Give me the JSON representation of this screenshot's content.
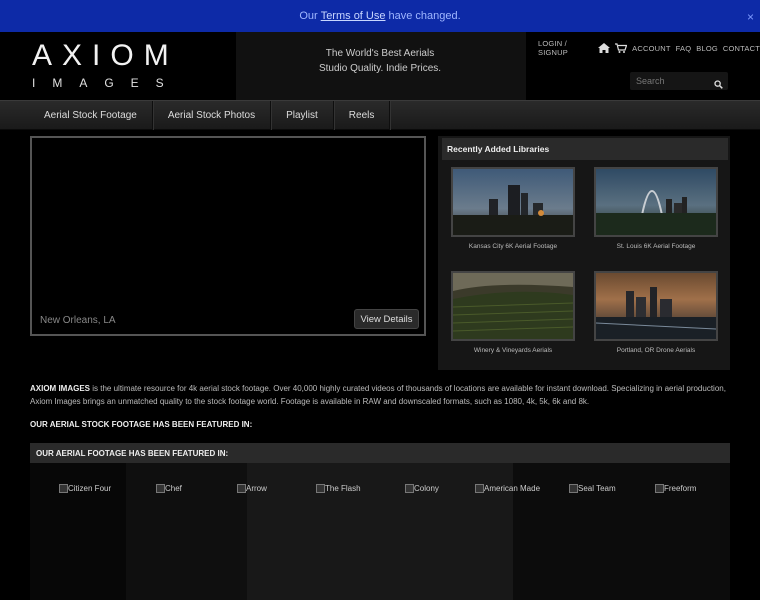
{
  "notice": {
    "prefix": "Our",
    "link": "Terms of Use",
    "suffix": "have changed.",
    "close": "×"
  },
  "brand": {
    "top": "AXIOM",
    "bottom": "IMAGES"
  },
  "tagline": {
    "line1": "The World's Best Aerials",
    "line2": "Studio Quality. Indie Prices."
  },
  "topnav": {
    "login": "LOGIN / SIGNUP",
    "account": "ACCOUNT",
    "faq": "FAQ",
    "blog": "BLOG",
    "contact": "CONTACT"
  },
  "search": {
    "placeholder": "Search"
  },
  "mainnav": [
    "Aerial Stock Footage",
    "Aerial Stock Photos",
    "Playlist",
    "Reels"
  ],
  "video": {
    "location": "New Orleans, LA",
    "button": "View Details"
  },
  "libraries": {
    "title": "Recently Added Libraries",
    "items": [
      {
        "caption": "Kansas City 6K Aerial Footage"
      },
      {
        "caption": "St. Louis 6K Aerial Footage"
      },
      {
        "caption": "Winery & Vineyards Aerials"
      },
      {
        "caption": "Portland, OR Drone Aerials"
      }
    ]
  },
  "description": {
    "brand": "AXIOM IMAGES",
    "body": "is the ultimate resource for 4k aerial stock footage. Over 40,000 highly curated videos of thousands of locations are available for instant download. Specializing in aerial production, Axiom Images brings an unmatched quality to the stock footage world. Footage is available in RAW and downscaled formats, such as 1080, 4k, 5k, 6k and 8k."
  },
  "featured_line": "OUR AERIAL STOCK FOOTAGE HAS BEEN FEATURED IN:",
  "featured": {
    "title": "OUR AERIAL FOOTAGE HAS BEEN FEATURED IN:",
    "logos": [
      "Citizen Four",
      "Chef",
      "Arrow",
      "The Flash",
      "Colony",
      "American Made",
      "Seal Team",
      "Freeform"
    ]
  }
}
